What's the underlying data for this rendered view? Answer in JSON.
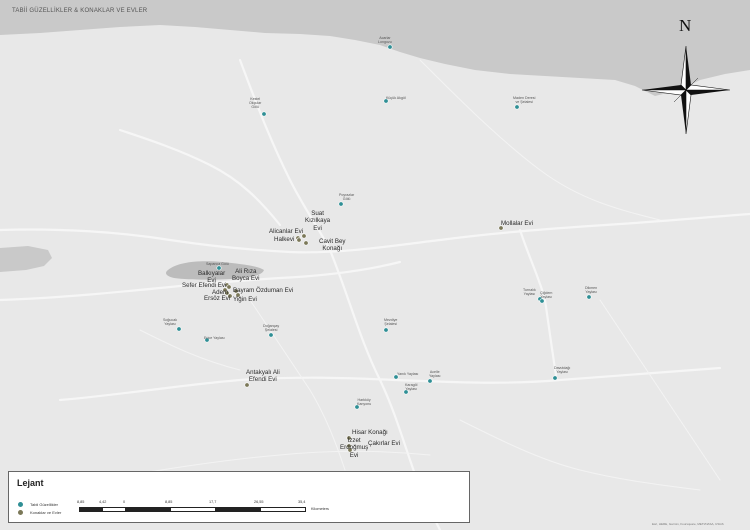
{
  "map": {
    "title": "TABİİ GÜZELLİKLER & KONAKLAR VE EVLER",
    "credit": "Esri, HERE, Garmin, Foursquare, METI/NASA, USGS",
    "compass_label": "N",
    "colors": {
      "land": "#e8e8e8",
      "sea": "#c9c9c9",
      "lake": "#bcbcbc",
      "road": "#f6f6f6",
      "tabii": "#2f8f95",
      "konak": "#7b7858"
    }
  },
  "tabii_guzellikler": [
    {
      "name": "Acarlar\nLongozu"
    },
    {
      "name": "Kestel\nOkçular\nGölü"
    },
    {
      "name": "Küçük Akgöl"
    },
    {
      "name": "Maden Deresi\nve Şelalesi"
    },
    {
      "name": "Poyrazlar\nGölü"
    },
    {
      "name": "Sapanca Gölü"
    },
    {
      "name": "Soğucak\nYaylası"
    },
    {
      "name": "Erice Yaylası"
    },
    {
      "name": "Doğançay\nŞelalesi"
    },
    {
      "name": "Mezdiye\nŞelalesi"
    },
    {
      "name": "Turnalık\nYaylası"
    },
    {
      "name": "Çiğdem\nYaylası"
    },
    {
      "name": "Dikmen\nYaylası"
    },
    {
      "name": "Yanık Yaylası"
    },
    {
      "name": "Acelle\nYaylası"
    },
    {
      "name": "Karagöl\nYaylası"
    },
    {
      "name": "Davutdağı\nYaylası"
    },
    {
      "name": "Harkköy\nKanyonu"
    }
  ],
  "konaklar_evler": [
    {
      "name": "Suat\nKızılkaya\nEvi"
    },
    {
      "name": "Alicanlar Evi"
    },
    {
      "name": "Halkevi"
    },
    {
      "name": "Cavit Bey\nKonağı"
    },
    {
      "name": "Mollalar Evi"
    },
    {
      "name": "Balkıyalar\nEvi"
    },
    {
      "name": "Ali Rıza\nBoyca Evi"
    },
    {
      "name": "Sefer Efendi Evi"
    },
    {
      "name": "Adem"
    },
    {
      "name": "Ersöz Evi"
    },
    {
      "name": "Bayram Özduman Evi"
    },
    {
      "name": "Yiğin Evi"
    },
    {
      "name": "Antakyalı Ali\nEfendi Evi"
    },
    {
      "name": "Hisar Konağı"
    },
    {
      "name": "İzzet\nErdoğmuş\nEvi"
    },
    {
      "name": "Çakırlar Evi"
    }
  ],
  "legend": {
    "title": "Lejant",
    "items": [
      {
        "label": "Tabii Güzellikler",
        "color": "#2f8f95"
      },
      {
        "label": "Konaklar ve Evler",
        "color": "#7b7858"
      }
    ]
  },
  "scale": {
    "ticks": [
      "8,85",
      "4,42",
      "0",
      "8,85",
      "17,7",
      "26,55",
      "35,4"
    ],
    "unit": "Kilometers"
  }
}
